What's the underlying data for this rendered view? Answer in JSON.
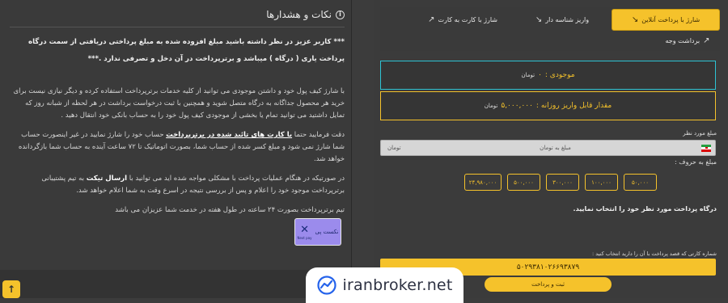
{
  "notes": {
    "title": "نکات و هشدارها",
    "p1": "*** کاربر عزیز در نظر داشته باشید مبلغ افزوده شده به مبلغ پرداختی دریافتی از سمت درگاه پرداخت یاری ( درگاه ) میباشد و برترپرداخت در آن دخل و تصرفی ندارد .***",
    "p2": "با شارژ کیف پول خود و داشتن موجودی می توانید از کلیه خدمات برترپرداخت استفاده کرده و دیگر نیازی نیست برای خرید هر محصول جداگانه به درگاه متصل شوید و همچنین با ثبت درخواست برداشت در هر لحظه از شبانه روز که تمایل داشتید می توانید تمام یا بخشی از موجودی کیف پول خود را به حساب بانکی خود انتقال دهید .",
    "p3_a": "دقت فرمایید حتما ",
    "p3_hl": "با کارت های تائید شده در برترپرداخت",
    "p3_b": " حساب خود را شارژ نمایید در غیر اینصورت حساب شما شارژ نمی شود و مبلغ کسر شده از حساب شما، بصورت اتوماتیک تا ۷۲ ساعت آینده به حساب شما بازگردانده خواهد شد.",
    "p4_a": "در صورتیکه در هنگام عملیات پرداخت با مشکلی مواجه شده اید می توانید با ",
    "p4_b": "ارسال تیکت",
    "p4_c": " به تیم پشتیبانی برترپرداخت موجود خود را اعلام و پس از بررسی نتیجه در اسرع وقت به شما اعلام خواهد شد.",
    "p5": "تیم برترپرداخت بصورت ۲۴ ساعته در طول هفته در خدمت شما عزیزان می باشد"
  },
  "tabs": {
    "online": "شارژ با پرداخت آنلاین",
    "deposit_id": "واریز شناسه دار",
    "card_to_card": "شارژ با کارت به کارت",
    "withdraw": "برداشت وجه"
  },
  "balance": {
    "label": "موجودی :",
    "value": "۰",
    "unit": "تومان"
  },
  "limit": {
    "label": "مقدار قابل واریز روزانه :",
    "value": "۵,۰۰۰,۰۰۰",
    "unit": "تومان"
  },
  "amount": {
    "label": "مبلغ مورد نظر",
    "placeholder": "مبلغ به تومان",
    "unit": "تومان",
    "in_words_label": "مبلغ به حروف :"
  },
  "chips": [
    "۲۴,۹۸۰,۰۰۰",
    "۵۰۰,۰۰۰",
    "۳۰۰,۰۰۰",
    "۱۰۰,۰۰۰",
    "۵۰,۰۰۰"
  ],
  "gateway": {
    "title": "درگاه پرداخت مورد نظر خود را انتخاب نمایید.",
    "name": "نکست پی",
    "sub": "Next pay"
  },
  "card": {
    "label": "شماره کارتی که قصد پرداخت با آن را دارید انتخاب کنید :",
    "number": "۵۰۲۹۳۸۱۰۲۶۶۹۳۸۷۹"
  },
  "submit": "ثبت و پرداخت",
  "watermark": "iranbroker.net",
  "scroll_top": "↑",
  "colors": {
    "accent": "#f5c22b",
    "cyan": "#2dc3d3",
    "gateway": "#9b8bec"
  }
}
